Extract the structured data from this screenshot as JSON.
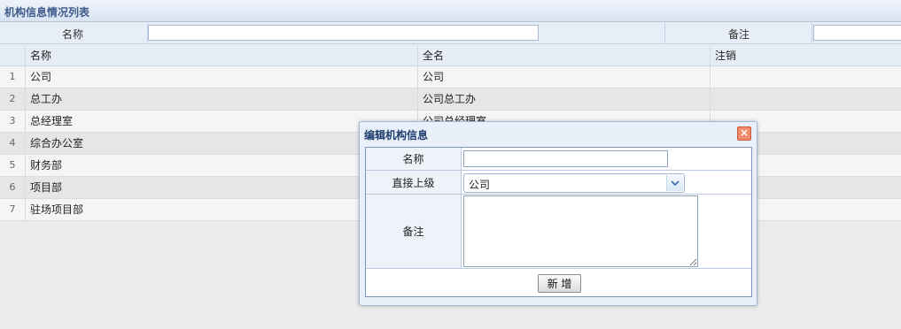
{
  "title": "机构信息情况列表",
  "search": {
    "name_label": "名称",
    "name_value": "",
    "remark_label": "备注",
    "remark_value": ""
  },
  "grid": {
    "columns": [
      "名称",
      "全名",
      "注销"
    ],
    "rows": [
      {
        "num": "1",
        "name": "公司",
        "fullname": "公司",
        "cancel": ""
      },
      {
        "num": "2",
        "name": "总工办",
        "fullname": "公司总工办",
        "cancel": ""
      },
      {
        "num": "3",
        "name": "总经理室",
        "fullname": "公司总经理室",
        "cancel": ""
      },
      {
        "num": "4",
        "name": "综合办公室",
        "fullname": "",
        "cancel": ""
      },
      {
        "num": "5",
        "name": "财务部",
        "fullname": "",
        "cancel": ""
      },
      {
        "num": "6",
        "name": "项目部",
        "fullname": "",
        "cancel": ""
      },
      {
        "num": "7",
        "name": "驻场项目部",
        "fullname": "",
        "cancel": ""
      }
    ]
  },
  "dialog": {
    "title": "编辑机构信息",
    "close_symbol": "×",
    "fields": {
      "name_label": "名称",
      "name_value": "",
      "parent_label": "直接上级",
      "parent_value": "公司",
      "remark_label": "备注",
      "remark_value": ""
    },
    "add_button": "新 增"
  },
  "icons": {
    "close": "close-icon",
    "dropdown": "chevron-down-icon"
  }
}
